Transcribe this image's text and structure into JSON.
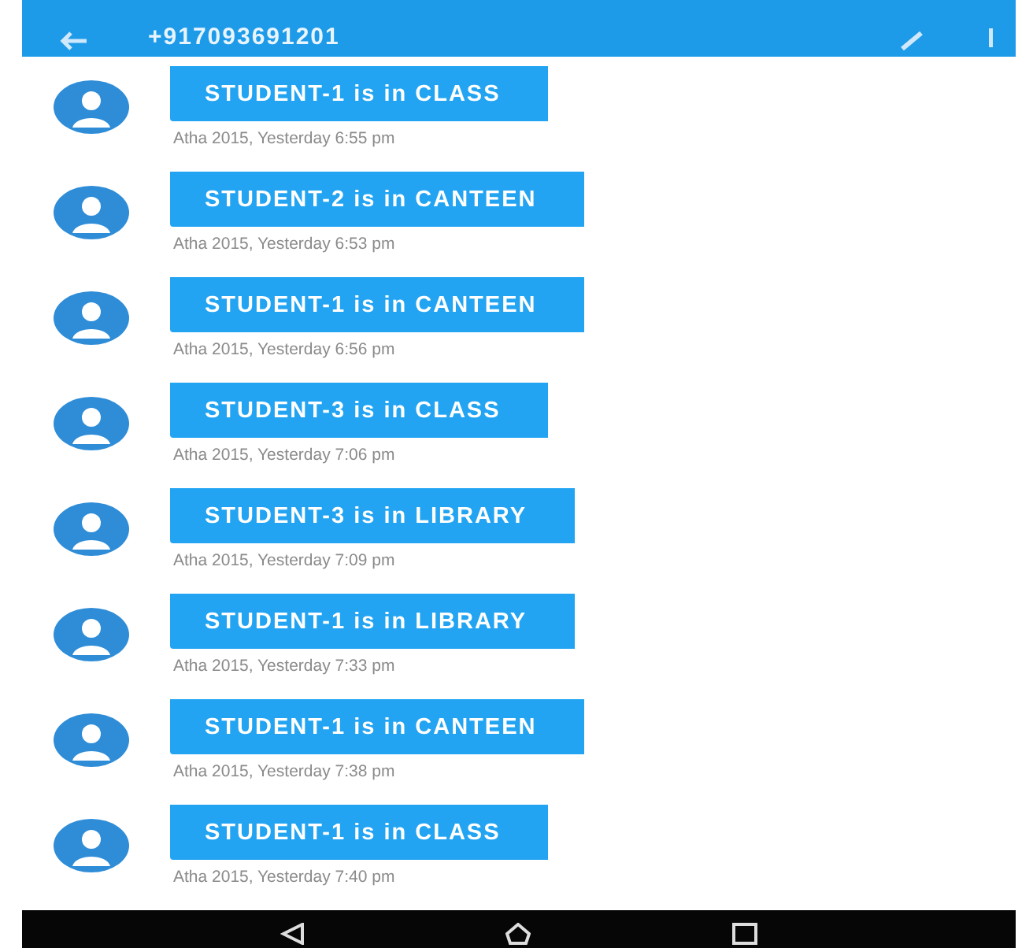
{
  "app_bar": {
    "title": "+917093691201"
  },
  "messages": [
    {
      "text": "STUDENT-1 is in CLASS",
      "meta": "Atha 2015, Yesterday 6:55 pm"
    },
    {
      "text": "STUDENT-2 is in CANTEEN",
      "meta": "Atha 2015, Yesterday 6:53 pm"
    },
    {
      "text": "STUDENT-1 is in CANTEEN",
      "meta": "Atha 2015, Yesterday 6:56 pm"
    },
    {
      "text": "STUDENT-3 is in CLASS",
      "meta": "Atha 2015, Yesterday 7:06 pm"
    },
    {
      "text": "STUDENT-3 is in LIBRARY",
      "meta": "Atha 2015, Yesterday 7:09 pm"
    },
    {
      "text": "STUDENT-1 is in LIBRARY",
      "meta": "Atha 2015, Yesterday 7:33 pm"
    },
    {
      "text": "STUDENT-1 is in CANTEEN",
      "meta": "Atha 2015, Yesterday 7:38 pm"
    },
    {
      "text": "STUDENT-1 is in CLASS",
      "meta": "Atha 2015, Yesterday 7:40 pm"
    }
  ]
}
